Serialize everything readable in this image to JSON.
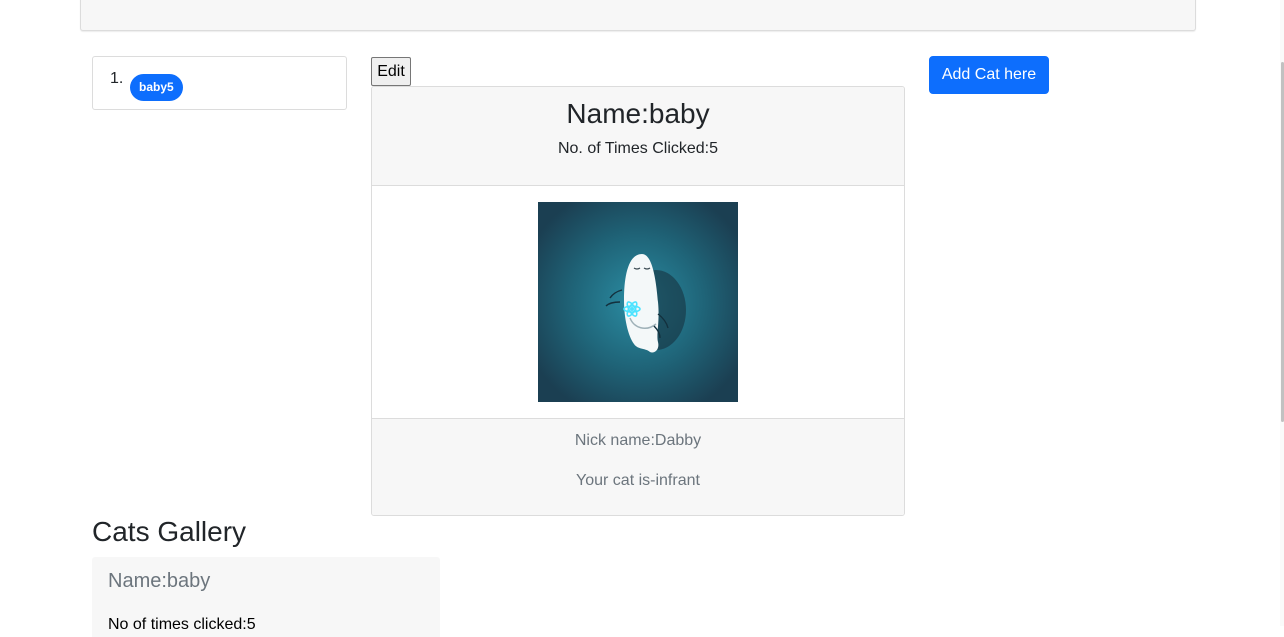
{
  "list": {
    "number": "1.",
    "items": [
      {
        "label": "baby5"
      }
    ]
  },
  "card": {
    "edit_label": "Edit",
    "title": "Name:baby",
    "clicks": "No. of Times Clicked:5",
    "image_alt": "cartoon ghost cat image",
    "nickname": "Nick name:Dabby",
    "age": "Your cat is-infrant"
  },
  "add_button_label": "Add Cat here",
  "gallery": {
    "heading": "Cats Gallery",
    "items": [
      {
        "name": "Name:baby",
        "clicks": "No of times clicked:5"
      }
    ]
  },
  "colors": {
    "primary": "#0d6efd",
    "panel_bg": "#f7f7f7",
    "muted_text": "#6c757d",
    "image_bg": "#1d5a6d"
  }
}
